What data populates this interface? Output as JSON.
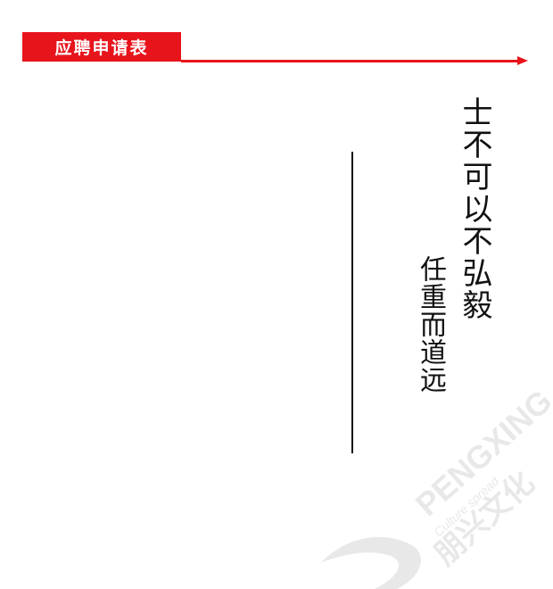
{
  "header": {
    "title": "应聘申请表",
    "accent_color": "#e8141c"
  },
  "calligraphy": {
    "main_text": "士不可以不弘毅",
    "signature": "任重而道远",
    "style": "handwritten-brush-calligraphy"
  },
  "watermark": {
    "brand": "PENGXING",
    "tagline": "Culture spread",
    "chinese_name": "朋兴文化",
    "logo_icon": "swoosh-logo-icon"
  }
}
